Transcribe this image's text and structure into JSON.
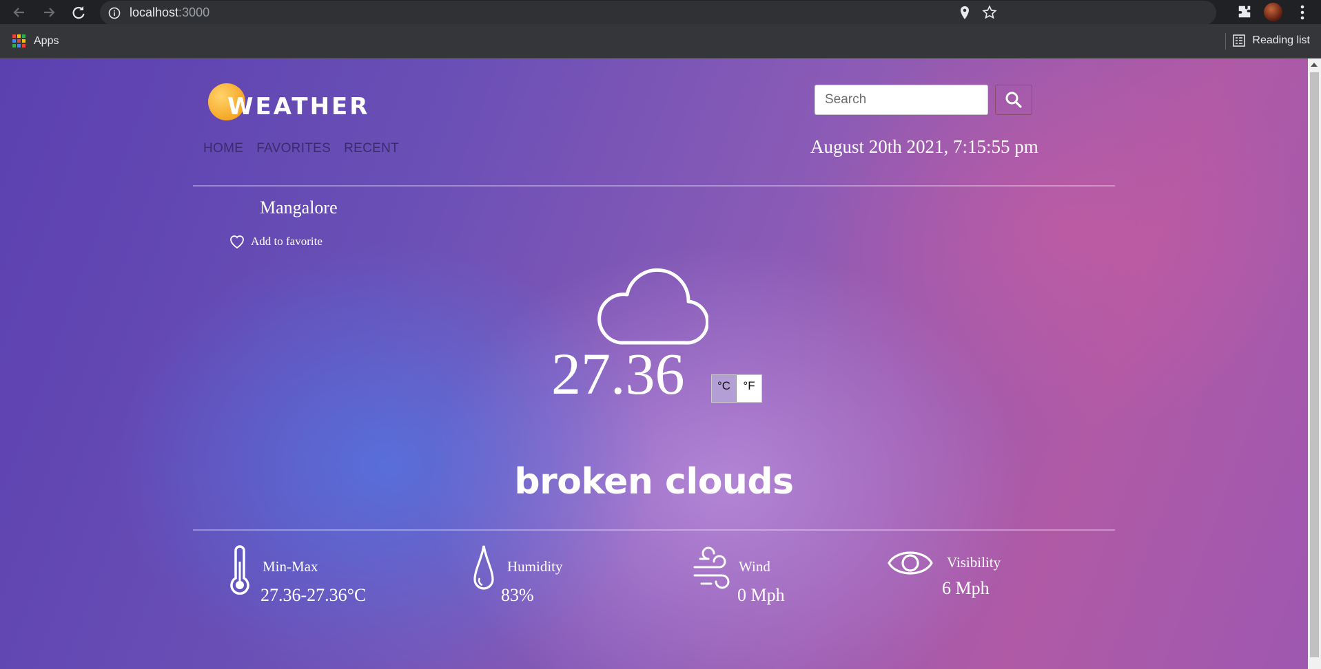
{
  "browser": {
    "url_host": "localhost",
    "url_port": ":3000",
    "bookmarks": {
      "apps_label": "Apps",
      "reading_list_label": "Reading list"
    }
  },
  "app": {
    "logo_text": "WEATHER",
    "nav": {
      "home": "HOME",
      "favorites": "FAVORITES",
      "recent": "RECENT"
    },
    "search": {
      "placeholder": "Search",
      "value": ""
    },
    "datetime": "August 20th 2021, 7:15:55 pm",
    "city": "Mangalore",
    "add_favorite_label": "Add to favorite",
    "temperature": "27.36",
    "units": {
      "celsius": "°C",
      "fahrenheit": "°F",
      "selected": "celsius"
    },
    "description": "broken clouds",
    "stats": {
      "minmax": {
        "label": "Min-Max",
        "value": "27.36-27.36°C"
      },
      "humidity": {
        "label": "Humidity",
        "value": "83%"
      },
      "wind": {
        "label": "Wind",
        "value": "0 Mph"
      },
      "visibility": {
        "label": "Visibility",
        "value": "6 Mph"
      }
    },
    "icons": {
      "weather": "cloud-icon",
      "minmax": "thermometer-icon",
      "humidity": "droplet-icon",
      "wind": "wind-icon",
      "visibility": "eye-icon"
    }
  }
}
